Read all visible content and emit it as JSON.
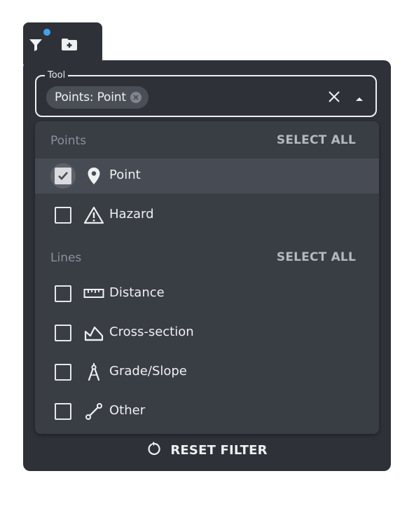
{
  "toolbar": {
    "filter_icon": "filter-icon",
    "new_folder_icon": "folder-plus-icon",
    "active_indicator_color": "#3ea2f0"
  },
  "field": {
    "legend": "Tool",
    "chip_label": "Points: Point",
    "clear_icon": "close-icon",
    "toggle_icon": "caret-up-icon"
  },
  "groups": [
    {
      "title": "Points",
      "select_all_label": "SELECT ALL",
      "options": [
        {
          "label": "Point",
          "icon": "map-pin-icon",
          "checked": true
        },
        {
          "label": "Hazard",
          "icon": "warning-icon",
          "checked": false
        }
      ]
    },
    {
      "title": "Lines",
      "select_all_label": "SELECT ALL",
      "options": [
        {
          "label": "Distance",
          "icon": "ruler-icon",
          "checked": false
        },
        {
          "label": "Cross-section",
          "icon": "cross-section-icon",
          "checked": false
        },
        {
          "label": "Grade/Slope",
          "icon": "compass-icon",
          "checked": false
        },
        {
          "label": "Other",
          "icon": "line-segment-icon",
          "checked": false
        }
      ]
    }
  ],
  "reset": {
    "label": "RESET FILTER",
    "icon": "reset-icon"
  },
  "colors": {
    "panel": "#2e3238",
    "dropdown": "#393e45",
    "selected_row": "#474c54"
  }
}
